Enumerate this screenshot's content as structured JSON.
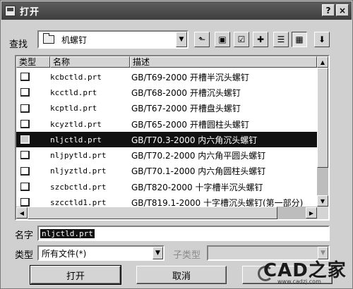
{
  "window": {
    "title": "打开",
    "help_glyph": "?",
    "close_glyph": "×"
  },
  "lookin": {
    "label": "查找",
    "value": "机螺钉",
    "icon": "folder-icon"
  },
  "toolbar": [
    {
      "name": "up-folder-icon",
      "glyph": "⬑"
    },
    {
      "name": "desktop-icon",
      "glyph": "▣"
    },
    {
      "name": "favorites-folder-icon",
      "glyph": "☑"
    },
    {
      "name": "new-folder-icon",
      "glyph": "✚"
    },
    {
      "name": "list-view-icon",
      "glyph": "☰"
    },
    {
      "name": "details-view-icon",
      "glyph": "▦"
    },
    {
      "name": "preview-icon",
      "glyph": "⬇"
    }
  ],
  "list": {
    "columns": {
      "type": "类型",
      "name": "名称",
      "desc": "描述"
    },
    "rows": [
      {
        "name": "kcbctld.prt",
        "desc": "GB/T69-2000 开槽半沉头螺钉"
      },
      {
        "name": "kcctld.prt",
        "desc": "GB/T68-2000 开槽沉头螺钉"
      },
      {
        "name": "kcptld.prt",
        "desc": "GB/T67-2000 开槽盘头螺钉"
      },
      {
        "name": "kcyztld.prt",
        "desc": "GB/T65-2000 开槽圆柱头螺钉"
      },
      {
        "name": "nljctld.prt",
        "desc": "GB/T70.3-2000 内六角沉头螺钉"
      },
      {
        "name": "nljpytld.prt",
        "desc": "GB/T70.2-2000 内六角平圆头螺钉"
      },
      {
        "name": "nljyztld.prt",
        "desc": "GB/T70.1-2000 内六角圆柱头螺钉"
      },
      {
        "name": "szcbctld.prt",
        "desc": "GB/T820-2000 十字槽半沉头螺钉"
      },
      {
        "name": "szcctld1.prt",
        "desc": "GB/T819.1-2000 十字槽沉头螺钉(第一部分)"
      }
    ],
    "selected_index": 4
  },
  "filename": {
    "label": "名字",
    "value": "nljctld.prt"
  },
  "filetype": {
    "label": "类型",
    "value": "所有文件(*)"
  },
  "subtype": {
    "label": "子类型",
    "value": ""
  },
  "buttons": {
    "open": "打开",
    "cancel": "取消",
    "third": ""
  },
  "watermark": {
    "text": "CAD之家",
    "url": "www.cadzj.com"
  }
}
